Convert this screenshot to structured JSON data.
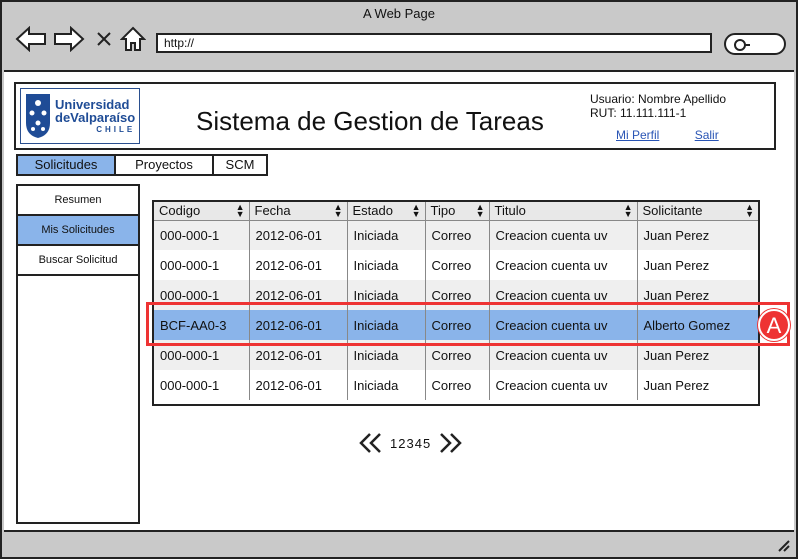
{
  "browser": {
    "window_title": "A Web Page",
    "url": "http://"
  },
  "header": {
    "logo": {
      "line1": "Universidad",
      "line2": "deValparaíso",
      "line3": "CHILE"
    },
    "title": "Sistema de Gestion de Tareas",
    "user_label": "Usuario: Nombre Apellido",
    "rut_label": "RUT: 11.111.111-1",
    "profile_link": "Mi Perfil",
    "logout_link": "Salir"
  },
  "tabs": [
    {
      "label": "Solicitudes",
      "active": true
    },
    {
      "label": "Proyectos",
      "active": false
    },
    {
      "label": "SCM",
      "active": false
    }
  ],
  "sidebar": [
    {
      "label": "Resumen",
      "active": false
    },
    {
      "label": "Mis Solicitudes",
      "active": true
    },
    {
      "label": "Buscar Solicitud",
      "active": false
    }
  ],
  "table": {
    "columns": [
      "Codigo",
      "Fecha",
      "Estado",
      "Tipo",
      "Titulo",
      "Solicitante"
    ],
    "rows": [
      [
        "000-000-1",
        "2012-06-01",
        "Iniciada",
        "Correo",
        "Creacion cuenta uv",
        "Juan Perez"
      ],
      [
        "000-000-1",
        "2012-06-01",
        "Iniciada",
        "Correo",
        "Creacion cuenta uv",
        "Juan Perez"
      ],
      [
        "000-000-1",
        "2012-06-01",
        "Iniciada",
        "Correo",
        "Creacion cuenta uv",
        "Juan Perez"
      ],
      [
        "BCF-AA0-3",
        "2012-06-01",
        "Iniciada",
        "Correo",
        "Creacion cuenta uv",
        "Alberto Gomez"
      ],
      [
        "000-000-1",
        "2012-06-01",
        "Iniciada",
        "Correo",
        "Creacion cuenta uv",
        "Juan Perez"
      ],
      [
        "000-000-1",
        "2012-06-01",
        "Iniciada",
        "Correo",
        "Creacion cuenta uv",
        "Juan Perez"
      ]
    ],
    "selected_row": 3
  },
  "annotation": {
    "marker": "A"
  },
  "pager": {
    "pages": [
      "1",
      "2",
      "3",
      "4",
      "5"
    ]
  },
  "colors": {
    "accent": "#8ab4ea",
    "highlight": "#e33333"
  }
}
